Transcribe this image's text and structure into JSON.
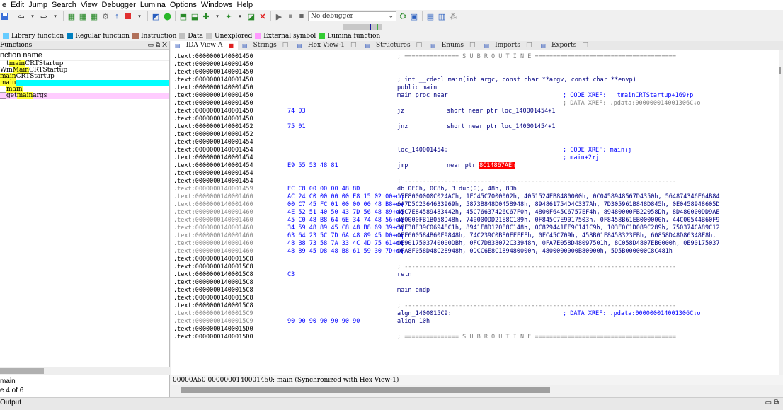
{
  "menu": [
    "e",
    "Edit",
    "Jump",
    "Search",
    "View",
    "Debugger",
    "Lumina",
    "Options",
    "Windows",
    "Help"
  ],
  "toolbar": {
    "debugger_select": "No debugger",
    "icons": [
      "save-icon",
      "back-icon",
      "forward-icon",
      "open-icon",
      "run-icon",
      "pause-icon",
      "stop-icon"
    ]
  },
  "legend": [
    {
      "label": "Library function",
      "color": "#66ccff"
    },
    {
      "label": "Regular function",
      "color": "#0080c0"
    },
    {
      "label": "Instruction",
      "color": "#b0705a"
    },
    {
      "label": "Data",
      "color": "#c0c0c0"
    },
    {
      "label": "Unexplored",
      "color": "#c8c8c8"
    },
    {
      "label": "External symbol",
      "color": "#ff99ff"
    },
    {
      "label": "Lumina function",
      "color": "#33cc33"
    }
  ],
  "functions": {
    "title": "Functions",
    "header": "nction name",
    "items": [
      {
        "pre": "__t",
        "hl": "main",
        "post": "CRTStartup",
        "kind": "normal"
      },
      {
        "pre": "Win",
        "hl": "Main",
        "post": "CRTStartup",
        "kind": "normal"
      },
      {
        "pre": "",
        "hl": "main",
        "post": "CRTStartup",
        "kind": "normal"
      },
      {
        "pre": "",
        "hl": "main",
        "post": "",
        "kind": "selected"
      },
      {
        "pre": "__",
        "hl": "main",
        "post": "",
        "kind": "normal"
      },
      {
        "pre": "__get",
        "hl": "main",
        "post": "args",
        "kind": "external"
      }
    ],
    "status_name": "main",
    "status_line": "e 4 of 6"
  },
  "tabs": [
    {
      "label": "IDA View-A",
      "active": true
    },
    {
      "label": "Strings",
      "active": false
    },
    {
      "label": "Hex View-1",
      "active": false
    },
    {
      "label": "Structures",
      "active": false
    },
    {
      "label": "Enums",
      "active": false
    },
    {
      "label": "Imports",
      "active": false
    },
    {
      "label": "Exports",
      "active": false
    }
  ],
  "disasm": [
    {
      "addr": ".text:0000000140001450",
      "plain": "; =============== S U B R O U T I N E =======================================",
      "cur": true
    },
    {
      "addr": ".text:0000000140001450"
    },
    {
      "addr": ".text:0000000140001450"
    },
    {
      "addr": ".text:0000000140001450",
      "ins": "; int __cdecl main(int argc, const char **argv, const char **envp)"
    },
    {
      "addr": ".text:0000000140001450",
      "ins": "public main"
    },
    {
      "addr": ".text:0000000140001450",
      "ins": "main proc near",
      "cmt_blue": "; CODE XREF: __tmainCRTStartup+169↑p"
    },
    {
      "addr": ".text:0000000140001450",
      "cmt": "; DATA XREF: .pdata:000000014001306C↓o"
    },
    {
      "addr": ".text:0000000140001450",
      "bytes": "74 03",
      "ins": "jz",
      "ops": "short near ptr loc_140001454+1",
      "bullet": "•"
    },
    {
      "addr": ".text:0000000140001450"
    },
    {
      "addr": ".text:0000000140001452",
      "bytes": "75 01",
      "ins": "jnz",
      "ops": "short near ptr loc_140001454+1",
      "bullet": "•"
    },
    {
      "addr": ".text:0000000140001452"
    },
    {
      "addr": ".text:0000000140001454"
    },
    {
      "addr": ".text:0000000140001454",
      "ins": "loc_140001454:",
      "cmt_blue": "; CODE XREF: main↑j"
    },
    {
      "addr": ".text:0000000140001454",
      "cmt_blue": "; main+2↑j"
    },
    {
      "addr": ".text:0000000140001454",
      "bytes": "E9 55 53 48 81",
      "ins": "jmp",
      "ops": "near ptr ",
      "ops_hl": "8C14867AEh",
      "bullet": "•"
    },
    {
      "addr": ".text:0000000140001454"
    },
    {
      "addr": ".text:0000000140001454",
      "plain": "; ---------------------------------------------------------------------------"
    },
    {
      "addr": ".text:0000000140001459",
      "bytes": "EC C8 00 00 00 48 8D",
      "data": "db 0ECh, 0C8h, 3 dup(0), 48h, 8Dh",
      "gray": true,
      "bullet": "•"
    },
    {
      "addr": ".text:0000000140001460",
      "bytes": "AC 24 C0 00 00 00 E8 15 02 00+dq",
      "data": "15E8000000C024ACh, 1FC45C7000002h, 4051524EB8480000h, 0C0458948567D4350h, 564874346E64B84",
      "gray": true,
      "bullet": "•"
    },
    {
      "addr": ".text:0000000140001460",
      "bytes": "00 C7 45 FC 01 00 00 00 48 B8+dq",
      "data": "6A7D5C2364633969h, 5873B848D0458948h, 894861754D4C337Ah, 7D305961B848D845h, 0E0458948605D",
      "gray": true
    },
    {
      "addr": ".text:0000000140001460",
      "bytes": "4E 52 51 40 50 43 7D 56 48 89+dq",
      "data": "45C7E84589483442h, 45C76637426C67F0h, 4800F645C6757EF4h, 89480000FB22058Dh, 8D480000DD9AE",
      "gray": true
    },
    {
      "addr": ".text:0000000140001460",
      "bytes": "45 C0 48 B8 64 6E 34 74 48 56+dq",
      "data": "480000FB1B058D48h, 740000DD21E8C189h, 0F845C7E9017503h, 0F8458B61EB000000h, 44C00544B60F9",
      "gray": true
    },
    {
      "addr": ".text:0000000140001460",
      "bytes": "34 59 48 89 45 C8 48 B8 69 39+dq",
      "data": "38E38E39C06948C1h, 8941F8D120E8C148h, 0C829441FF9C141C9h, 103E0C1D089C289h, 750374CA89C12",
      "gray": true
    },
    {
      "addr": ".text:0000000140001460",
      "bytes": "63 64 23 5C 7D 6A 48 89 45 D0+dq",
      "data": "0FF600584B60F9848h, 74C239C0BE0FFFFFh, 0FC45C709h, 458B01F8458323EBh, 60858D48D86348F8h,",
      "gray": true
    },
    {
      "addr": ".text:0000000140001460",
      "bytes": "48 B8 73 58 7A 33 4C 4D 75 61+dq",
      "data": "0E9017503740000DBh, 0FC7D838072C33948h, 0FA7E058D48097501h, 8C058D4807EB0000h, 0E90175037",
      "gray": true
    },
    {
      "addr": ".text:0000000140001460",
      "bytes": "48 89 45 D8 48 B8 61 59 30 7D+dq",
      "data": "0FA8F058D48C28948h, 0DCC6E8C189480000h, 4800000000B80000h, 5D5B000000C8C481h",
      "gray": true
    },
    {
      "addr": ".text:00000001400015C8"
    },
    {
      "addr": ".text:00000001400015C8",
      "plain": "; ---------------------------------------------------------------------------"
    },
    {
      "addr": ".text:00000001400015C8",
      "bytes": "C3",
      "ins": "retn",
      "bullet": "•"
    },
    {
      "addr": ".text:00000001400015C8"
    },
    {
      "addr": ".text:00000001400015C8",
      "ins": "main endp"
    },
    {
      "addr": ".text:00000001400015C8"
    },
    {
      "addr": ".text:00000001400015C8",
      "plain": "; ---------------------------------------------------------------------------"
    },
    {
      "addr": ".text:00000001400015C9",
      "ins": "algn_1400015C9:",
      "cmt_blue": "; DATA XREF: .pdata:000000014001306C↓o",
      "gray": true
    },
    {
      "addr": ".text:00000001400015C9",
      "bytes": "90 90 90 90 90 90 90",
      "ins": "align 10h",
      "gray": true,
      "bullet": "•"
    },
    {
      "addr": ".text:00000001400015D0"
    },
    {
      "addr": ".text:00000001400015D0",
      "plain": "; =============== S U B R O U T I N E ======================================="
    }
  ],
  "sync_status": "00000A50 0000000140001450: main (Synchronized with Hex View-1)",
  "output": {
    "label": "Output"
  }
}
